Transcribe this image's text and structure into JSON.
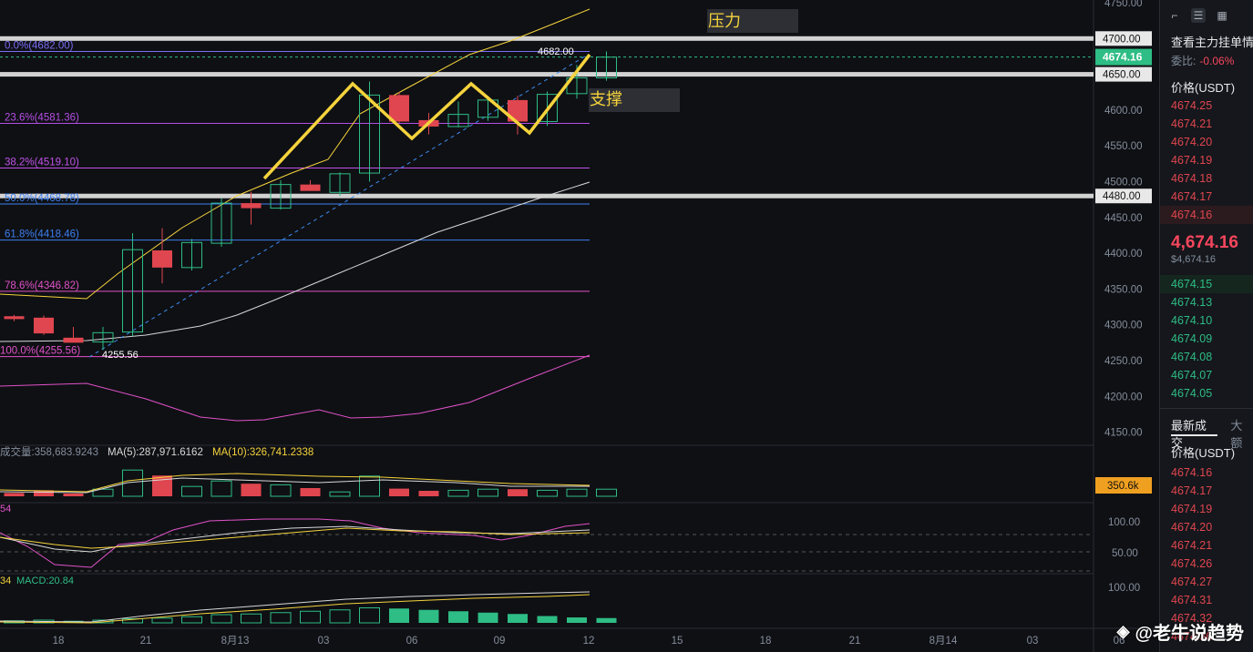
{
  "price_axis": {
    "labels": [
      "4750.00",
      "4700.00",
      "4650.00",
      "4600.00",
      "4550.00",
      "4500.00",
      "4450.00",
      "4400.00",
      "4350.00",
      "4300.00",
      "4250.00",
      "4200.00",
      "4150.00"
    ],
    "values": [
      4750,
      4700,
      4650,
      4600,
      4550,
      4500,
      4450,
      4400,
      4350,
      4300,
      4250,
      4200,
      4150
    ],
    "tag_4700": "4700.00",
    "tag_4650": "4650.00",
    "tag_4480": "4480.00",
    "current_price_tag": "4674.16",
    "volume_tag": "350.6k",
    "osc1_labels": [
      "100.00",
      "50.00"
    ],
    "osc2_label": "100.00"
  },
  "time_axis": {
    "labels": [
      "18",
      "21",
      "8月13",
      "03",
      "06",
      "09",
      "12",
      "15",
      "18",
      "21",
      "8月14",
      "03",
      "06"
    ]
  },
  "fib": [
    {
      "label": "0.0%(4682.00)",
      "price": 4682.0,
      "color": "#7b6cf6"
    },
    {
      "label": "23.6%(4581.36)",
      "price": 4581.36,
      "color": "#b44ee6"
    },
    {
      "label": "38.2%(4519.10)",
      "price": 4519.1,
      "color": "#c051e8"
    },
    {
      "label": "50.0%(4468.78)",
      "price": 4468.78,
      "color": "#3c7ff0"
    },
    {
      "label": "61.8%(4418.46)",
      "price": 4418.46,
      "color": "#3c7ff0"
    },
    {
      "label": "78.6%(4346.82)",
      "price": 4346.82,
      "color": "#e052c8"
    },
    {
      "label": "100.0%(4255.56)",
      "price": 4255.56,
      "color": "#e052c8"
    }
  ],
  "annotations": {
    "high_label": "4682.00",
    "low_label": "4255.56",
    "resistance": "压力",
    "support": "支撑"
  },
  "volume": {
    "text": "成交量:358,683.9243",
    "ma5": "MA(5):287,971.6162",
    "ma10": "MA(10):326,741.2338"
  },
  "indicators": {
    "osc1_fragment": "54",
    "macd_fragment": "34",
    "macd": "MACD:20.84"
  },
  "chart_data": {
    "type": "candlestick",
    "x": [
      "18",
      "21",
      "8月13",
      "03",
      "06",
      "09",
      "12"
    ],
    "candles": [
      {
        "o": 4312,
        "h": 4314,
        "l": 4305,
        "c": 4308
      },
      {
        "o": 4310,
        "h": 4313,
        "l": 4286,
        "c": 4288
      },
      {
        "o": 4282,
        "h": 4297,
        "l": 4276,
        "c": 4275
      },
      {
        "o": 4276,
        "h": 4297,
        "l": 4265,
        "c": 4289
      },
      {
        "o": 4290,
        "h": 4428,
        "l": 4284,
        "c": 4405
      },
      {
        "o": 4404,
        "h": 4435,
        "l": 4358,
        "c": 4380
      },
      {
        "o": 4380,
        "h": 4420,
        "l": 4376,
        "c": 4415
      },
      {
        "o": 4414,
        "h": 4477,
        "l": 4409,
        "c": 4470
      },
      {
        "o": 4470,
        "h": 4486,
        "l": 4440,
        "c": 4463
      },
      {
        "o": 4463,
        "h": 4502,
        "l": 4461,
        "c": 4496
      },
      {
        "o": 4496,
        "h": 4502,
        "l": 4488,
        "c": 4487
      },
      {
        "o": 4485,
        "h": 4513,
        "l": 4480,
        "c": 4511
      },
      {
        "o": 4512,
        "h": 4640,
        "l": 4500,
        "c": 4621
      },
      {
        "o": 4621,
        "h": 4625,
        "l": 4582,
        "c": 4584
      },
      {
        "o": 4586,
        "h": 4596,
        "l": 4566,
        "c": 4577
      },
      {
        "o": 4577,
        "h": 4612,
        "l": 4576,
        "c": 4594
      },
      {
        "o": 4590,
        "h": 4620,
        "l": 4585,
        "c": 4614
      },
      {
        "o": 4614,
        "h": 4620,
        "l": 4566,
        "c": 4584
      },
      {
        "o": 4584,
        "h": 4626,
        "l": 4578,
        "c": 4622
      },
      {
        "o": 4623,
        "h": 4663,
        "l": 4616,
        "c": 4645
      },
      {
        "o": 4645,
        "h": 4682,
        "l": 4641,
        "c": 4674
      }
    ],
    "volumes": [
      6,
      11,
      5,
      13,
      48,
      38,
      18,
      28,
      23,
      21,
      15,
      8,
      37,
      14,
      10,
      11,
      13,
      13,
      11,
      13,
      13
    ],
    "macd_hist": [
      3,
      4,
      3,
      4,
      6,
      7,
      9,
      12,
      13,
      15,
      17,
      19,
      22,
      21,
      19,
      17,
      15,
      13,
      10,
      8,
      7
    ]
  },
  "sidebar": {
    "title": "查看主力挂单情",
    "ratio_label": "委比:",
    "ratio_value": "-0.06%",
    "price_header": "价格(USDT)",
    "asks": [
      "4674.25",
      "4674.21",
      "4674.20",
      "4674.19",
      "4674.18",
      "4674.17",
      "4674.16"
    ],
    "last_price": "4,674.16",
    "last_price_sub": "$4,674.16",
    "bids": [
      "4674.15",
      "4674.13",
      "4674.10",
      "4674.09",
      "4674.08",
      "4674.07",
      "4674.05"
    ],
    "tab_trades": "最新成交",
    "tab_big": "大额",
    "trades_header": "价格(USDT)",
    "trades": [
      "4674.16",
      "4674.17",
      "4674.19",
      "4674.20",
      "4674.21",
      "4674.26",
      "4674.27",
      "4674.31",
      "4674.32",
      "4674.36"
    ]
  },
  "watermark": "@老牛说趋势",
  "colors": {
    "up": "#2ebd85",
    "down": "#e0464f",
    "yellow": "#f5d33c",
    "pressure_bg": "#2d2f35"
  }
}
